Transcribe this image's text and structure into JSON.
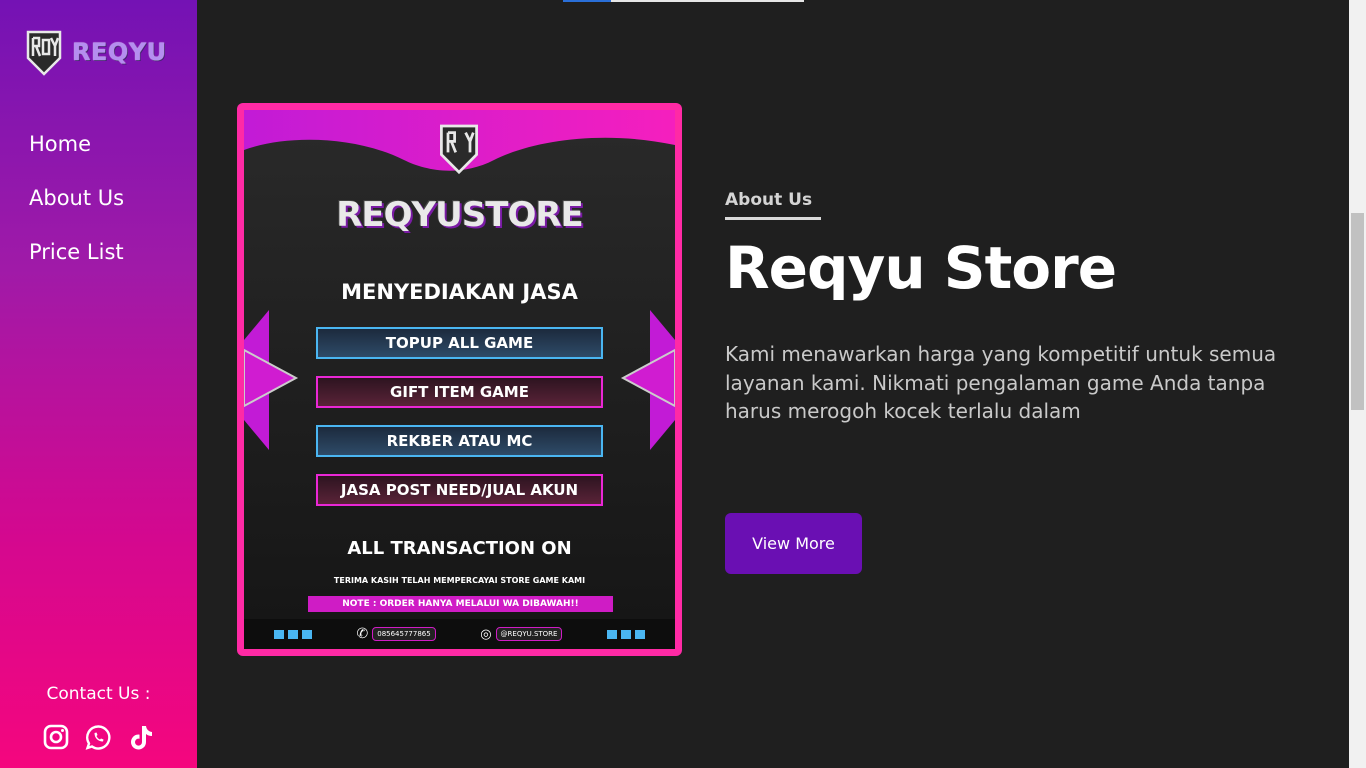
{
  "sidebar": {
    "brand": "REQYU",
    "nav": [
      {
        "label": "Home"
      },
      {
        "label": "About Us"
      },
      {
        "label": "Price List"
      }
    ],
    "contact_label": "Contact Us :",
    "socials": [
      "instagram-icon",
      "whatsapp-icon",
      "tiktok-icon"
    ]
  },
  "poster": {
    "title": "REQYUSTORE",
    "subtitle": "MENYEDIAKAN JASA",
    "services": [
      "TOPUP ALL GAME",
      "GIFT ITEM GAME",
      "REKBER ATAU MC",
      "JASA POST NEED/JUAL AKUN"
    ],
    "transaction": "ALL TRANSACTION ON",
    "thanks": "TERIMA KASIH TELAH MEMPERCAYAI STORE GAME KAMI",
    "note": "NOTE : ORDER HANYA MELALUI WA DIBAWAH!!",
    "whatsapp": "085645777865",
    "instagram": "@REQYU.STORE"
  },
  "about": {
    "label": "About Us",
    "title": "Reqyu Store",
    "description": "Kami menawarkan harga yang kompetitif untuk semua layanan kami. Nikmati pengalaman game Anda tanpa harus merogoh kocek terlalu dalam",
    "button": "View More"
  },
  "colors": {
    "accent": "#6a0fb3",
    "sidebar_top": "#7412b4",
    "sidebar_bottom": "#f5067e",
    "poster_border": "#ff2aa5",
    "background": "#1f1f1f"
  }
}
